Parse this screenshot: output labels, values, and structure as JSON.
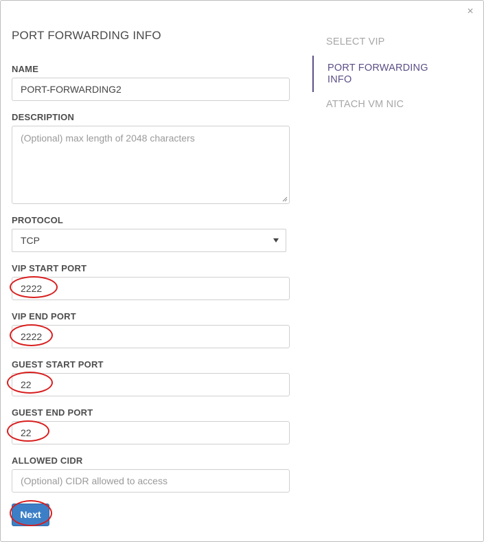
{
  "dialog": {
    "close_glyph": "×",
    "title": "PORT FORWARDING INFO"
  },
  "form": {
    "name": {
      "label": "NAME",
      "value": "PORT-FORWARDING2"
    },
    "description": {
      "label": "DESCRIPTION",
      "placeholder": "(Optional) max length of 2048 characters"
    },
    "protocol": {
      "label": "PROTOCOL",
      "value": "TCP"
    },
    "vip_start_port": {
      "label": "VIP START PORT",
      "value": "2222"
    },
    "vip_end_port": {
      "label": "VIP END PORT",
      "value": "2222"
    },
    "guest_start_port": {
      "label": "GUEST START PORT",
      "value": "22"
    },
    "guest_end_port": {
      "label": "GUEST END PORT",
      "value": "22"
    },
    "allowed_cidr": {
      "label": "ALLOWED CIDR",
      "placeholder": "(Optional) CIDR allowed to access"
    },
    "next_label": "Next"
  },
  "steps": [
    {
      "label": "SELECT VIP",
      "active": false
    },
    {
      "label": "PORT FORWARDING\nINFO",
      "active": true
    },
    {
      "label": "ATTACH VM NIC",
      "active": false
    }
  ],
  "colors": {
    "accent": "#5b4e86",
    "primary_button": "#3d7fc6",
    "annotation_ring": "#d81e1e"
  }
}
